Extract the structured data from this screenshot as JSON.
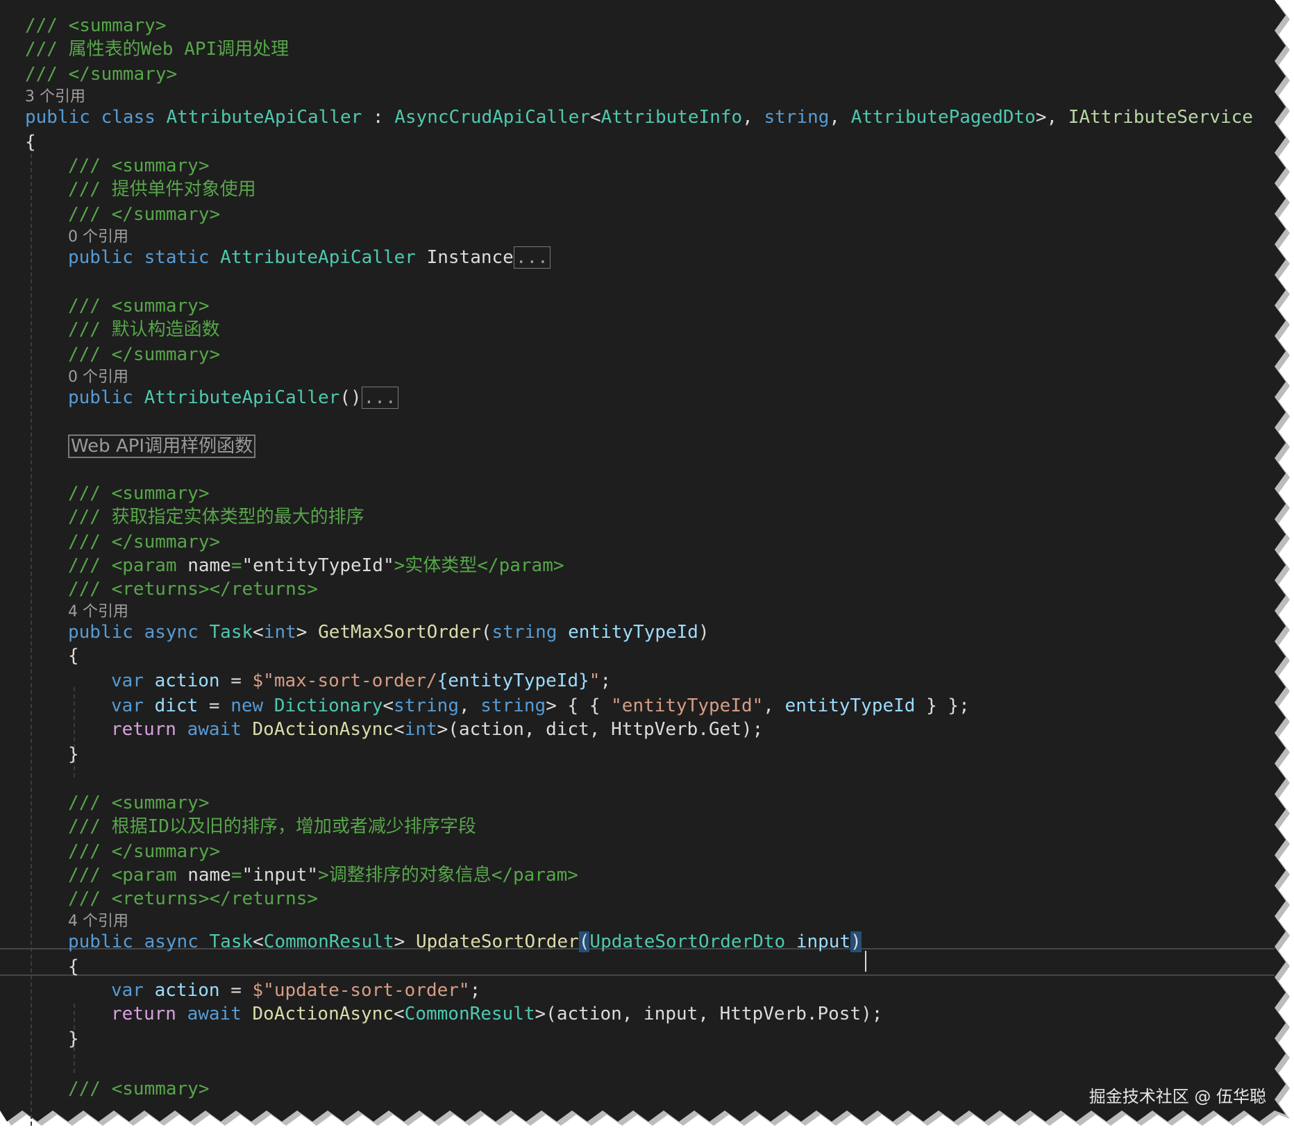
{
  "code_lines": [
    {
      "kind": "comment",
      "text": "/// <summary>"
    },
    {
      "kind": "comment",
      "text": "/// 属性表的Web API调用处理"
    },
    {
      "kind": "comment",
      "text": "/// </summary>"
    },
    {
      "kind": "codelens",
      "text": "3 个引用"
    },
    {
      "kind": "class_decl",
      "public": "public",
      "class": "class",
      "name": "AttributeApiCaller",
      "colon": " : ",
      "base": "AsyncCrudApiCaller",
      "lt": "<",
      "arg1": "AttributeInfo",
      "comma1": ", ",
      "arg2": "string",
      "comma2": ", ",
      "arg3": "AttributePagedDto",
      "gt": ">, ",
      "iface": "IAttributeService"
    },
    {
      "kind": "brace",
      "text": "{"
    },
    {
      "kind": "comment",
      "text": "/// <summary>"
    },
    {
      "kind": "comment",
      "text": "/// 提供单件对象使用"
    },
    {
      "kind": "comment",
      "text": "/// </summary>"
    },
    {
      "kind": "codelens",
      "text": "0 个引用"
    },
    {
      "kind": "property",
      "public": "public",
      "static": "static",
      "type": "AttributeApiCaller",
      "name": "Instance",
      "collapsed": "..."
    },
    {
      "kind": "comment",
      "text": "/// <summary>"
    },
    {
      "kind": "comment",
      "text": "/// 默认构造函数"
    },
    {
      "kind": "comment",
      "text": "/// </summary>"
    },
    {
      "kind": "codelens",
      "text": "0 个引用"
    },
    {
      "kind": "ctor",
      "public": "public",
      "name": "AttributeApiCaller",
      "parens": "()",
      "collapsed": "..."
    },
    {
      "kind": "region",
      "text": "Web API调用样例函数"
    },
    {
      "kind": "comment",
      "text": "/// <summary>"
    },
    {
      "kind": "comment",
      "text": "/// 获取指定实体类型的最大的排序"
    },
    {
      "kind": "comment",
      "text": "/// </summary>"
    },
    {
      "kind": "param_doc",
      "prefix": "/// <param ",
      "attr": "name",
      "eq": "=",
      "value": "\"entityTypeId\"",
      "content": ">实体类型</param>"
    },
    {
      "kind": "comment",
      "text": "/// <returns></returns>"
    },
    {
      "kind": "codelens",
      "text": "4 个引用"
    },
    {
      "kind": "method1",
      "public": "public",
      "async": "async",
      "task": "Task",
      "lt": "<",
      "int": "int",
      "gt": ">",
      "name": "GetMaxSortOrder",
      "open": "(",
      "ptype": "string",
      "pname": "entityTypeId",
      "close": ")"
    },
    {
      "kind": "brace",
      "text": "{"
    },
    {
      "kind": "stmt_action1",
      "var": "var",
      "name": "action",
      "eq": " = ",
      "dollar": "$",
      "str1": "\"max-sort-order/",
      "interp": "{entityTypeId}",
      "str2": "\"",
      "end": ";"
    },
    {
      "kind": "stmt_dict",
      "var": "var",
      "name": "dict",
      "eq": " = ",
      "new": "new",
      "type": "Dictionary",
      "lt": "<",
      "t1": "string",
      "comma": ", ",
      "t2": "string",
      "gt": ">",
      "open": " { { ",
      "key": "\"entityTypeId\"",
      "sep": ", ",
      "val": "entityTypeId",
      "close": " } };"
    },
    {
      "kind": "stmt_return1",
      "return": "return",
      "await": "await",
      "fn": "DoActionAsync",
      "lt": "<",
      "int": "int",
      "gt": ">",
      "args": "(action, dict, HttpVerb.Get);"
    },
    {
      "kind": "brace",
      "text": "}"
    },
    {
      "kind": "comment",
      "text": "/// <summary>"
    },
    {
      "kind": "comment",
      "text": "/// 根据ID以及旧的排序，增加或者减少排序字段"
    },
    {
      "kind": "comment",
      "text": "/// </summary>"
    },
    {
      "kind": "param_doc",
      "prefix": "/// <param ",
      "attr": "name",
      "eq": "=",
      "value": "\"input\"",
      "content": ">调整排序的对象信息</param>"
    },
    {
      "kind": "comment",
      "text": "/// <returns></returns>"
    },
    {
      "kind": "codelens",
      "text": "4 个引用"
    },
    {
      "kind": "method2",
      "public": "public",
      "async": "async",
      "task": "Task",
      "lt": "<",
      "type": "CommonResult",
      "gt": ">",
      "name": "UpdateSortOrder",
      "open": "(",
      "ptype": "UpdateSortOrderDto",
      "pname": "input",
      "close": ")"
    },
    {
      "kind": "brace",
      "text": "{"
    },
    {
      "kind": "stmt_action2",
      "var": "var",
      "name": "action",
      "eq": " = ",
      "dollar": "$",
      "str": "\"update-sort-order\"",
      "end": ";"
    },
    {
      "kind": "stmt_return2",
      "return": "return",
      "await": "await",
      "fn": "DoActionAsync",
      "lt": "<",
      "type": "CommonResult",
      "gt": ">",
      "args": "(action, input, HttpVerb.Post);"
    },
    {
      "kind": "brace",
      "text": "}"
    },
    {
      "kind": "comment",
      "text": "/// <summary>"
    }
  ],
  "watermark": "掘金技术社区 @ 伍华聪",
  "colors": {
    "background": "#1e1e1e",
    "comment": "#57a64a",
    "keyword": "#569cd6",
    "control_keyword": "#d8a0df",
    "type": "#4ec9b0",
    "interface": "#b8d7a3",
    "string": "#d69d85",
    "identifier": "#9cdcfe",
    "method": "#dcdcaa",
    "plain": "#dcdcdc"
  }
}
